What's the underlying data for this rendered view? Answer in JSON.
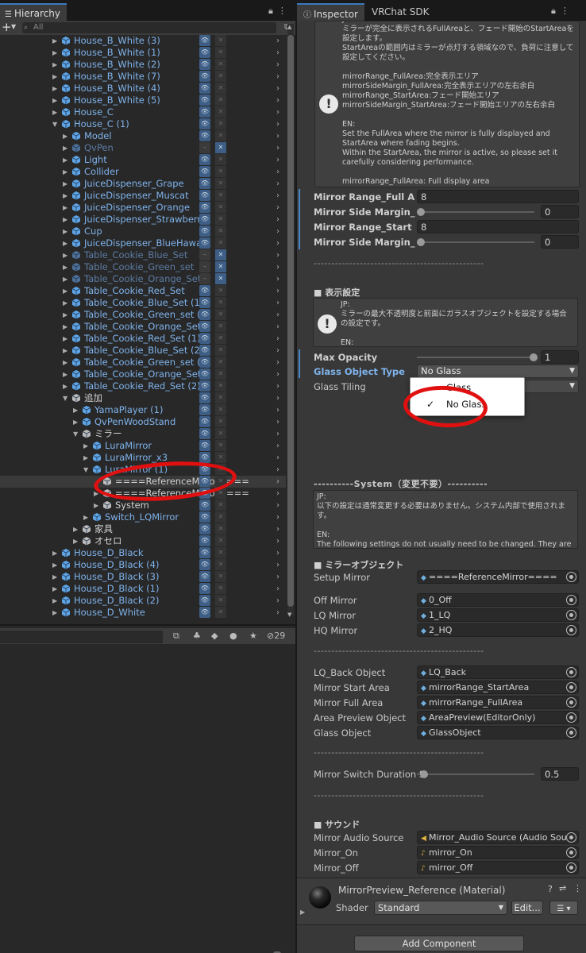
{
  "hierarchy": {
    "tab_label": "Hierarchy",
    "add_label": "+",
    "search_placeholder": "All",
    "rows": [
      {
        "label": "House_B_White (3)",
        "style": "blue",
        "indent": 1,
        "fold": "▶",
        "vis": "on",
        "pick": "off"
      },
      {
        "label": "House_B_White (1)",
        "style": "blue",
        "indent": 1,
        "fold": "▶",
        "vis": "on",
        "pick": "off"
      },
      {
        "label": "House_B_White (2)",
        "style": "blue",
        "indent": 1,
        "fold": "▶",
        "vis": "on",
        "pick": "off"
      },
      {
        "label": "House_B_White (7)",
        "style": "blue",
        "indent": 1,
        "fold": "▶",
        "vis": "on",
        "pick": "off"
      },
      {
        "label": "House_B_White (4)",
        "style": "blue",
        "indent": 1,
        "fold": "▶",
        "vis": "on",
        "pick": "off"
      },
      {
        "label": "House_B_White (5)",
        "style": "blue",
        "indent": 1,
        "fold": "▶",
        "vis": "on",
        "pick": "off"
      },
      {
        "label": "House_C",
        "style": "blue",
        "indent": 1,
        "fold": "▶",
        "vis": "on",
        "pick": "off"
      },
      {
        "label": "House_C (1)",
        "style": "blue",
        "indent": 1,
        "fold": "▼",
        "vis": "on",
        "pick": "off"
      },
      {
        "label": "Model",
        "style": "blue",
        "indent": 2,
        "fold": "▶",
        "vis": "on",
        "pick": "off"
      },
      {
        "label": "QvPen",
        "style": "dim",
        "indent": 2,
        "fold": "▶",
        "vis": "off",
        "pick": "on"
      },
      {
        "label": "Light",
        "style": "blue",
        "indent": 2,
        "fold": "▶",
        "vis": "on",
        "pick": "off"
      },
      {
        "label": "Collider",
        "style": "blue",
        "indent": 2,
        "fold": "▶",
        "vis": "on",
        "pick": "off"
      },
      {
        "label": "JuiceDispenser_Grape",
        "style": "blue",
        "indent": 2,
        "fold": "▶",
        "vis": "on",
        "pick": "off"
      },
      {
        "label": "JuiceDispenser_Muscat",
        "style": "blue",
        "indent": 2,
        "fold": "▶",
        "vis": "on",
        "pick": "off"
      },
      {
        "label": "JuiceDispenser_Orange",
        "style": "blue",
        "indent": 2,
        "fold": "▶",
        "vis": "on",
        "pick": "off"
      },
      {
        "label": "JuiceDispenser_Strawberry",
        "style": "blue",
        "indent": 2,
        "fold": "▶",
        "vis": "on",
        "pick": "off"
      },
      {
        "label": "Cup",
        "style": "blue",
        "indent": 2,
        "fold": "▶",
        "vis": "on",
        "pick": "off"
      },
      {
        "label": "JuiceDispenser_BlueHawaii",
        "style": "blue",
        "indent": 2,
        "fold": "▶",
        "vis": "on",
        "pick": "off"
      },
      {
        "label": "Table_Cookie_Blue_Set",
        "style": "dim",
        "indent": 2,
        "fold": "▶",
        "vis": "off",
        "pick": "on"
      },
      {
        "label": "Table_Cookie_Green_set",
        "style": "dim",
        "indent": 2,
        "fold": "▶",
        "vis": "off",
        "pick": "on"
      },
      {
        "label": "Table_Cookie_Orange_Set",
        "style": "dim",
        "indent": 2,
        "fold": "▶",
        "vis": "off",
        "pick": "on"
      },
      {
        "label": "Table_Cookie_Red_Set",
        "style": "blue",
        "indent": 2,
        "fold": "▶",
        "vis": "on",
        "pick": "off"
      },
      {
        "label": "Table_Cookie_Blue_Set (1)",
        "style": "blue",
        "indent": 2,
        "fold": "▶",
        "vis": "on",
        "pick": "off"
      },
      {
        "label": "Table_Cookie_Green_set (1)",
        "style": "blue",
        "indent": 2,
        "fold": "▶",
        "vis": "on",
        "pick": "off"
      },
      {
        "label": "Table_Cookie_Orange_Set (",
        "style": "blue",
        "indent": 2,
        "fold": "▶",
        "vis": "on",
        "pick": "off"
      },
      {
        "label": "Table_Cookie_Red_Set (1)",
        "style": "blue",
        "indent": 2,
        "fold": "▶",
        "vis": "on",
        "pick": "off"
      },
      {
        "label": "Table_Cookie_Blue_Set (2)",
        "style": "blue",
        "indent": 2,
        "fold": "▶",
        "vis": "on",
        "pick": "off"
      },
      {
        "label": "Table_Cookie_Green_set (2",
        "style": "blue",
        "indent": 2,
        "fold": "▶",
        "vis": "on",
        "pick": "off"
      },
      {
        "label": "Table_Cookie_Orange_Set (",
        "style": "blue",
        "indent": 2,
        "fold": "▶",
        "vis": "on",
        "pick": "off"
      },
      {
        "label": "Table_Cookie_Red_Set (2)",
        "style": "blue",
        "indent": 2,
        "fold": "▶",
        "vis": "on",
        "pick": "off"
      },
      {
        "label": "追加",
        "style": "white",
        "indent": 2,
        "fold": "▼",
        "vis": "on",
        "pick": "off"
      },
      {
        "label": "YamaPlayer (1)",
        "style": "blue",
        "indent": 3,
        "fold": "▶",
        "vis": "on",
        "pick": "off"
      },
      {
        "label": "QvPenWoodStand",
        "style": "blue",
        "indent": 3,
        "fold": "▶",
        "vis": "on",
        "pick": "off"
      },
      {
        "label": "ミラー",
        "style": "white",
        "indent": 3,
        "fold": "▼",
        "vis": "on",
        "pick": "off"
      },
      {
        "label": "LuraMirror",
        "style": "blue",
        "indent": 4,
        "fold": "▶",
        "vis": "on",
        "pick": "off"
      },
      {
        "label": "LuraMirror_x3",
        "style": "blue",
        "indent": 4,
        "fold": "▶",
        "vis": "on",
        "pick": "off"
      },
      {
        "label": "LuraMirror (1)",
        "style": "blue",
        "indent": 4,
        "fold": "▼",
        "vis": "on",
        "pick": "off"
      },
      {
        "label": "====ReferenceMirror====",
        "style": "white",
        "indent": 5,
        "fold": "",
        "vis": "on",
        "pick": "off",
        "selected": true
      },
      {
        "label": "====ReferenceMirror====",
        "style": "white",
        "indent": 5,
        "fold": "▶",
        "vis": "on",
        "pick": "off"
      },
      {
        "label": "System",
        "style": "white",
        "indent": 5,
        "fold": "▶",
        "vis": "on",
        "pick": "off"
      },
      {
        "label": "Switch_LQMirror",
        "style": "blue",
        "indent": 4,
        "fold": "▶",
        "vis": "on",
        "pick": "off"
      },
      {
        "label": "家具",
        "style": "white",
        "indent": 3,
        "fold": "▶",
        "vis": "on",
        "pick": "off"
      },
      {
        "label": "オセロ",
        "style": "white",
        "indent": 3,
        "fold": "▶",
        "vis": "on",
        "pick": "off"
      },
      {
        "label": "House_D_Black",
        "style": "blue",
        "indent": 1,
        "fold": "▶",
        "vis": "on",
        "pick": "off"
      },
      {
        "label": "House_D_Black (4)",
        "style": "blue",
        "indent": 1,
        "fold": "▶",
        "vis": "on",
        "pick": "off"
      },
      {
        "label": "House_D_Black (3)",
        "style": "blue",
        "indent": 1,
        "fold": "▶",
        "vis": "on",
        "pick": "off"
      },
      {
        "label": "House_D_Black (1)",
        "style": "blue",
        "indent": 1,
        "fold": "▶",
        "vis": "on",
        "pick": "off"
      },
      {
        "label": "House_D_Black (2)",
        "style": "blue",
        "indent": 1,
        "fold": "▶",
        "vis": "on",
        "pick": "off"
      },
      {
        "label": "House_D_White",
        "style": "blue",
        "indent": 1,
        "fold": "▶",
        "vis": "on",
        "pick": "off"
      }
    ]
  },
  "project": {
    "hidden_count": "29"
  },
  "inspector": {
    "tab_label": "Inspector",
    "tab2_label": "VRChat SDK",
    "help1": "JP:\nミラーが完全に表示されるFullAreaと、フェード開始のStartAreaを設定します。\nStartAreaの範囲内はミラーが点灯する領域なので、負荷に注意して設定してください。\n\nmirrorRange_FullArea:完全表示エリア\nmirrorSideMargin_FullArea:完全表示エリアの左右余白\nmirrorRange_StartArea:フェード開始エリア\nmirrorSideMargin_StartArea:フェード開始エリアの左右余白\n\nEN:\nSet the FullArea where the mirror is fully displayed and StartArea where fading begins.\nWithin the StartArea, the mirror is active, so please set it carefully considering performance.\n\nmirrorRange_FullArea: Full display area\nmirrorSideMargin_FullArea: Left/right margin for full display area\nmirrorRange_StartArea: Fade start area\nmirrorSideMargin_StartArea: Left/right margin for fade start area",
    "props1": [
      {
        "label": "Mirror Range_Full Area",
        "value": "8"
      },
      {
        "label": "Mirror Side Margin_Full",
        "value": "0"
      },
      {
        "label": "Mirror Range_Start Area",
        "value": "8"
      },
      {
        "label": "Mirror Side Margin_Start",
        "value": "0"
      }
    ],
    "divider": "------------------------------------------------",
    "section_display": "■ 表示設定",
    "help2": "JP:\nミラーの最大不透明度と前面にガラスオブジェクトを設定する場合の設定です。\n\nEN:\nSettings for mirror maximum opacity and front glass object configuration.",
    "max_opacity_label": "Max Opacity",
    "max_opacity_value": "1",
    "glass_type_label": "Glass Object Type",
    "glass_type_value": "No Glass",
    "glass_tiling_label": "Glass Tiling",
    "popup_options": [
      "Glass",
      "No Glass"
    ],
    "system_divider": "----------System（変更不要）----------",
    "help3": "JP:\n以下の設定は通常変更する必要はありません。システム内部で使用されます。\n\nEN:\nThe following settings do not usually need to be changed. They are used internally by the system.",
    "section_mirror_obj": "■ ミラーオブジェクト",
    "setup_mirror_label": "Setup Mirror",
    "setup_mirror_value": "====ReferenceMirror====",
    "mirror_objs": [
      {
        "label": "Off Mirror",
        "value": "0_Off"
      },
      {
        "label": "LQ Mirror",
        "value": "1_LQ"
      },
      {
        "label": "HQ Mirror",
        "value": "2_HQ"
      }
    ],
    "system_objs": [
      {
        "label": "LQ_Back Object",
        "value": "LQ_Back"
      },
      {
        "label": "Mirror Start Area",
        "value": "mirrorRange_StartArea"
      },
      {
        "label": "Mirror Full Area",
        "value": "mirrorRange_FullArea"
      },
      {
        "label": "Area Preview Object",
        "value": "AreaPreview(EditorOnly)"
      },
      {
        "label": "Glass Object",
        "value": "GlassObject"
      }
    ],
    "switch_duration_label": "Mirror Switch Duration S",
    "switch_duration_value": "0.5",
    "section_sound": "■ サウンド",
    "sound_objs": [
      {
        "label": "Mirror Audio Source",
        "value": "Mirror_Audio Source (Audio Sour"
      },
      {
        "label": "Mirror_On",
        "value": "mirror_On"
      },
      {
        "label": "Mirror_Off",
        "value": "mirror_Off"
      }
    ],
    "material_title": "MirrorPreview_Reference (Material)",
    "shader_label": "Shader",
    "shader_value": "Standard",
    "edit_label": "Edit...",
    "add_component": "Add Component"
  },
  "colors": {
    "accent": "#3a79bb",
    "annotation": "#e11010"
  }
}
